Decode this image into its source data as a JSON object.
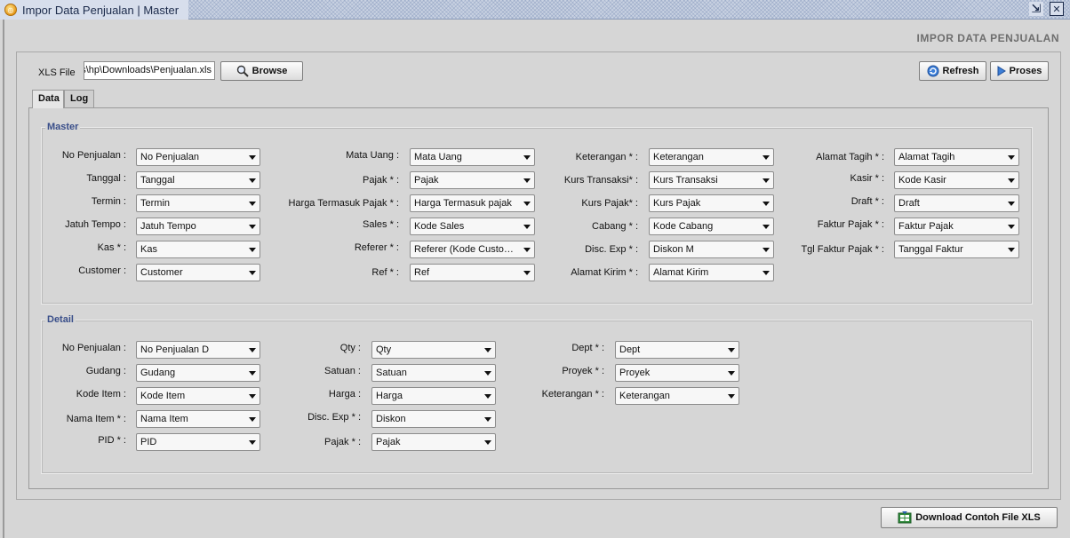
{
  "window": {
    "title": "Impor Data Penjualan | Master"
  },
  "page_heading": "IMPOR DATA PENJUALAN",
  "file": {
    "label": "XLS File",
    "value": "C:\\Users\\hp\\Downloads\\Penjualan.xls",
    "browse_label": "Browse"
  },
  "toolbar": {
    "refresh_label": "Refresh",
    "proses_label": "Proses"
  },
  "tabs": [
    {
      "label": "Data"
    },
    {
      "label": "Log"
    }
  ],
  "master": {
    "legend": "Master",
    "col1": [
      {
        "label": "No Penjualan :",
        "value": "No Penjualan"
      },
      {
        "label": "Tanggal :",
        "value": "Tanggal"
      },
      {
        "label": "Termin :",
        "value": "Termin"
      },
      {
        "label": "Jatuh Tempo :",
        "value": "Jatuh Tempo"
      },
      {
        "label": "Kas * :",
        "value": "Kas"
      },
      {
        "label": "Customer :",
        "value": "Customer"
      }
    ],
    "col2": [
      {
        "label": "Mata Uang :",
        "value": "Mata Uang"
      },
      {
        "label": "Pajak * :",
        "value": "Pajak"
      },
      {
        "label": "Harga Termasuk Pajak * :",
        "value": "Harga Termasuk pajak"
      },
      {
        "label": "Sales * :",
        "value": "Kode Sales"
      },
      {
        "label": "Referer * :",
        "value": "Referer (Kode Customer)"
      },
      {
        "label": "Ref * :",
        "value": "Ref"
      }
    ],
    "col3": [
      {
        "label": "Keterangan * :",
        "value": "Keterangan"
      },
      {
        "label": "Kurs Transaksi* :",
        "value": "Kurs Transaksi"
      },
      {
        "label": "Kurs Pajak* :",
        "value": "Kurs Pajak"
      },
      {
        "label": "Cabang * :",
        "value": "Kode Cabang"
      },
      {
        "label": "Disc. Exp * :",
        "value": "Diskon M"
      },
      {
        "label": "Alamat Kirim * :",
        "value": "Alamat Kirim"
      }
    ],
    "col4": [
      {
        "label": "Alamat Tagih * :",
        "value": "Alamat Tagih"
      },
      {
        "label": "Kasir * :",
        "value": "Kode Kasir"
      },
      {
        "label": "Draft * :",
        "value": "Draft"
      },
      {
        "label": "Faktur Pajak * :",
        "value": "Faktur Pajak"
      },
      {
        "label": "Tgl Faktur Pajak * :",
        "value": "Tanggal Faktur"
      }
    ]
  },
  "detail": {
    "legend": "Detail",
    "col1": [
      {
        "label": "No Penjualan :",
        "value": "No Penjualan D"
      },
      {
        "label": "Gudang :",
        "value": "Gudang"
      },
      {
        "label": "Kode Item :",
        "value": "Kode Item"
      },
      {
        "label": "Nama Item * :",
        "value": "Nama Item"
      },
      {
        "label": "PID * :",
        "value": "PID"
      }
    ],
    "col2": [
      {
        "label": "Qty :",
        "value": "Qty"
      },
      {
        "label": "Satuan :",
        "value": "Satuan"
      },
      {
        "label": "Harga :",
        "value": "Harga"
      },
      {
        "label": "Disc. Exp * :",
        "value": "Diskon"
      },
      {
        "label": "Pajak * :",
        "value": "Pajak"
      }
    ],
    "col3": [
      {
        "label": "Dept * :",
        "value": "Dept"
      },
      {
        "label": "Proyek * :",
        "value": "Proyek"
      },
      {
        "label": "Keterangan * :",
        "value": "Keterangan"
      }
    ]
  },
  "download_label": "Download Contoh File XLS"
}
